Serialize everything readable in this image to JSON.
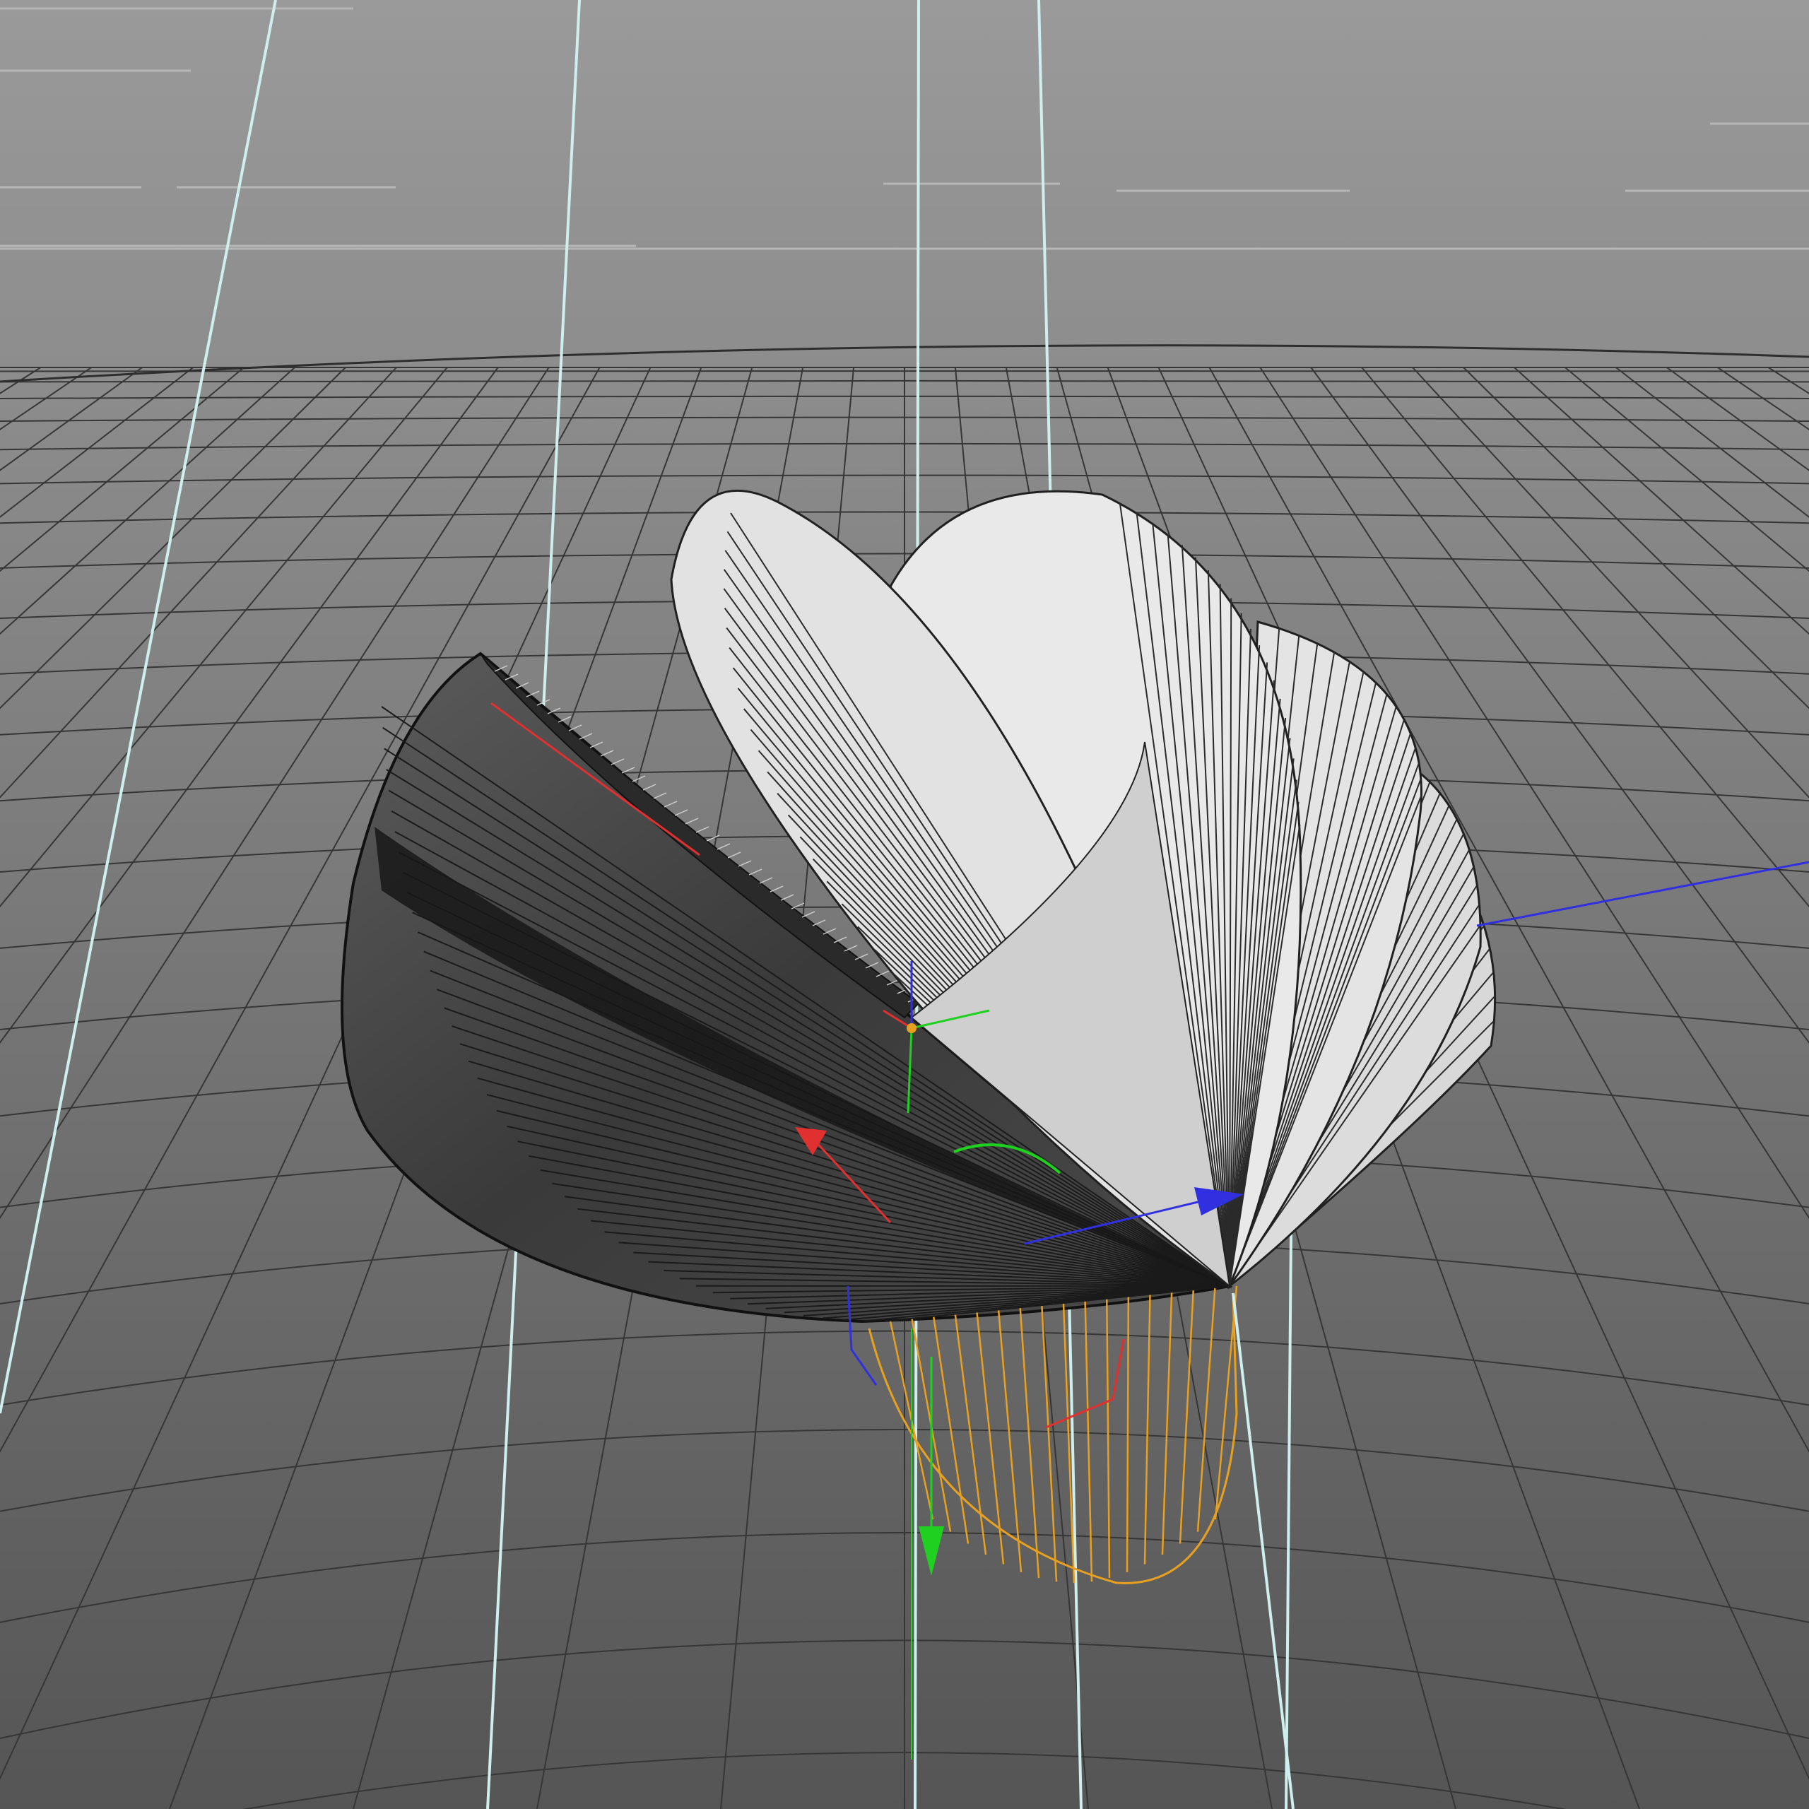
{
  "viewport": {
    "mode": "perspective-3d-viewport",
    "background_gradient": [
      "#9a9a9a",
      "#7b7b7b",
      "#545454"
    ],
    "floor_grid_color": "#363636",
    "guide_line_color": "#cfeeee"
  },
  "scene": {
    "object": "fanned-half-disc-petals",
    "light_petal_fill": "#e7e7e7",
    "dark_petal_fill": "#4a4a4a",
    "selected_spline_color": "#e8a020"
  },
  "gizmo": {
    "x_axis_color": "#e03030",
    "y_axis_color": "#20d020",
    "z_axis_color": "#3030e0"
  }
}
